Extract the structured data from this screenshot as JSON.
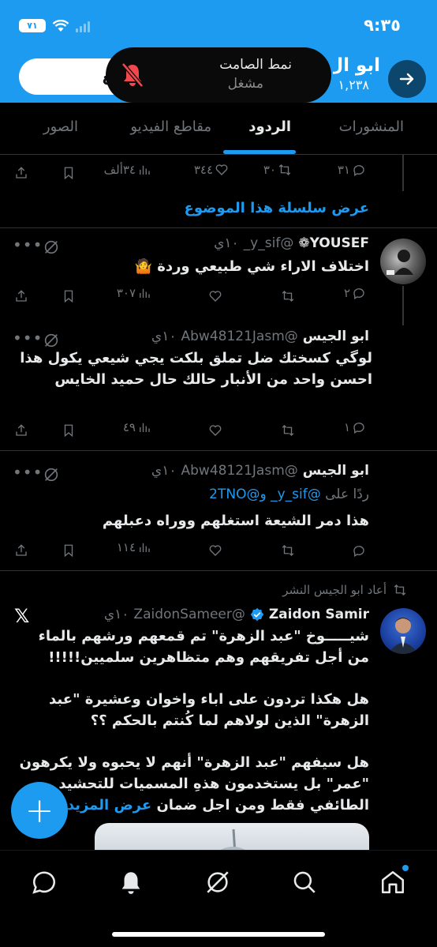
{
  "status_bar": {
    "time": "٩:٣٥",
    "battery": "٧١"
  },
  "header": {
    "name": "ابو ال",
    "count": "١,٢٣٨",
    "follow_label": "تابع",
    "colors": {
      "brand": "#1d9bf0"
    }
  },
  "notification": {
    "title": "نمط الصامت",
    "subtitle": "مشغل"
  },
  "tabs": [
    {
      "label": "المنشورات"
    },
    {
      "label": "الردود"
    },
    {
      "label": "مقاطع الفيديو"
    },
    {
      "label": "الصور"
    }
  ],
  "top_actions": {
    "replies": "٣١",
    "reposts": "٣٠",
    "likes": "٣٤٤",
    "views": "٣٤ألف"
  },
  "show_thread": "عرض سلسلة هذا الموضوع",
  "tweets": [
    {
      "name": "YOUSEF❁",
      "handle": "@y_sif_",
      "time": "١٠ي",
      "text": "اختلاف الاراء شي طبيعي وردة 🤷",
      "replies": "٢",
      "views": "٣٠٧"
    },
    {
      "name": "ابو الجيس",
      "handle": "@Abw48121Jasm",
      "time": "١٠ي",
      "text": "لوگي كسختك ضل تملق بلكت يجي شيعي يكول هذا احسن واحد من الأنبار حالك حال حميد الخايس",
      "replies": "١",
      "views": "٤٩"
    },
    {
      "name": "ابو الجيس",
      "handle": "@Abw48121Jasm",
      "time": "١٠ي",
      "reply_to_prefix": "ردًا على",
      "reply_to_users": "@y_sif_ و@2TNO",
      "text": "هذا دمر الشيعة استغلهم ووراه دعبلهم",
      "views": "١١٤"
    }
  ],
  "repost": {
    "label": "أعاد ابو الجيس النشر",
    "name": "Zaidon Samir",
    "handle": "@ZaidonSameer",
    "time": "١٠ي",
    "para1": "شيـــــوخ \"عبد الزهرة\" تم قمعهم ورشهم بالماء من أجل تفريقهم وهم متظاهرين سلميين!!!!!",
    "para2": "هل هكذا تردون على اباء واخوان وعشيرة \"عبد الزهرة\" الذين لولاهم لما كُنتم بالحكم ؟؟",
    "para3": "هل سيفهم \"عبد الزهرة\" أنهم لا يحبوه ولا يكرهون \"عمر\" بل يستخدمون هذهِ المسميات للتحشيد الطائفي فقط ومن اجل ضمان",
    "show_more": "عرض المزيد"
  },
  "fab_label": "+",
  "nav": [
    "home-icon",
    "search-icon",
    "grok-icon",
    "notifications-icon",
    "messages-icon"
  ]
}
